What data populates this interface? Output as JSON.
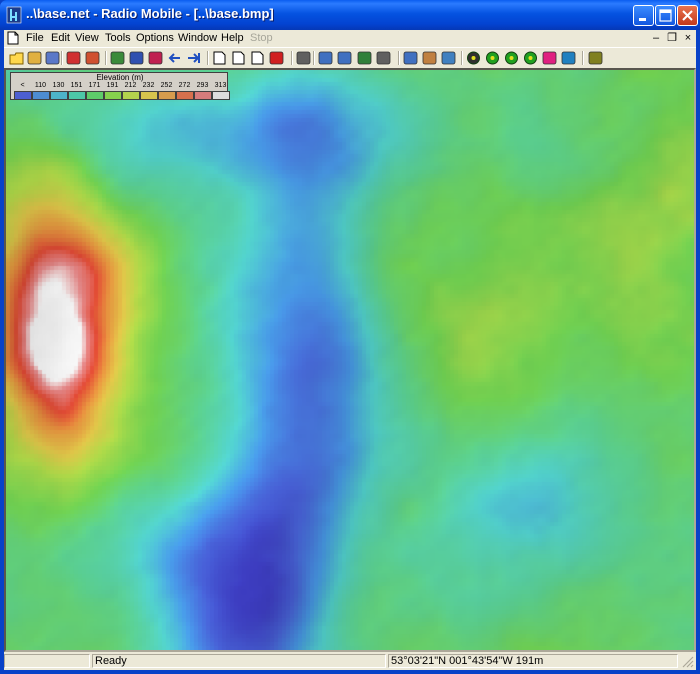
{
  "window": {
    "title": "..\\base.net - Radio Mobile - [..\\base.bmp]"
  },
  "menu": {
    "items": [
      "File",
      "Edit",
      "View",
      "Tools",
      "Options",
      "Window",
      "Help"
    ],
    "stop_label": "Stop"
  },
  "toolbar": {
    "icons": [
      "new-icon",
      "open-icon",
      "save-icon",
      "network-properties-icon",
      "unit-properties-icon",
      "globe-icon",
      "map-properties-icon",
      "picture-icon",
      "back-icon",
      "forward-icon",
      "page-icon",
      "page-link-icon",
      "page-2-icon",
      "pdf-icon",
      "print-icon",
      "copy-icon",
      "paste-icon",
      "merge-icon",
      "fit-icon",
      "rectangle-icon",
      "person-icon",
      "zoom-fit-icon",
      "text-icon",
      "radio-link-icon",
      "radio-coverage-icon",
      "polar-coverage-icon",
      "cartesian-icon",
      "visual-icon",
      "export-icon"
    ]
  },
  "legend": {
    "title": "Elevation (m)",
    "ticks": [
      "<",
      "110",
      "130",
      "151",
      "171",
      "191",
      "212",
      "232",
      "252",
      "272",
      "293",
      "313"
    ],
    "colors": [
      "#4D5FD1",
      "#4D8CD1",
      "#4DB4C9",
      "#4DC8A8",
      "#5ECC6A",
      "#86D14D",
      "#B4D14D",
      "#D6C44D",
      "#D69C4D",
      "#D6704D",
      "#D67C7C",
      "#DDDDDD"
    ]
  },
  "status": {
    "ready": "Ready",
    "coords": "53°03'21\"N 001°43'54\"W 191m"
  }
}
